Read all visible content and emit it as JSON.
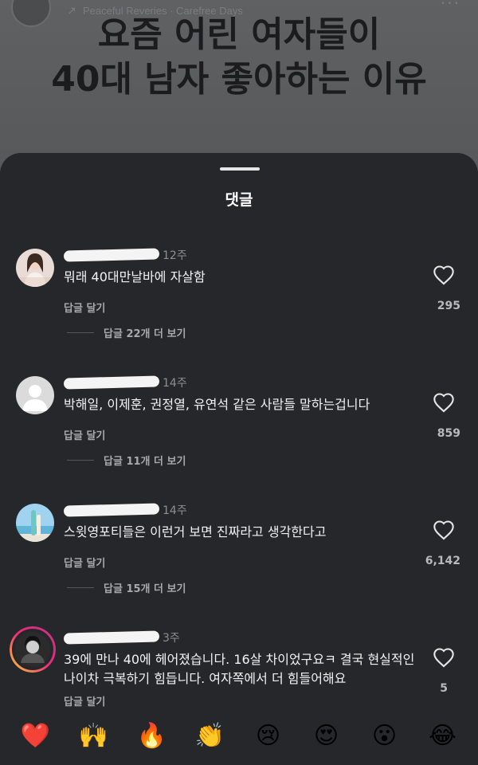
{
  "post": {
    "audio_label": "Peaceful Reveries · Carefree Days",
    "headline_line1": "요즘 어린 여자들이",
    "headline_line2": "40대 남자 좋아하는 이유",
    "more_label": "···"
  },
  "sheet": {
    "title": "댓글"
  },
  "comments": [
    {
      "time": "12주",
      "text": "뭐래 40대만날바에 자살함",
      "reply_label": "답글 달기",
      "likes": "295",
      "view_replies": "답글 22개 더 보기"
    },
    {
      "time": "14주",
      "text": "박해일, 이제훈, 권정열, 유연석 같은 사람들 말하는겁니다",
      "reply_label": "답글 달기",
      "likes": "859",
      "view_replies": "답글 11개 더 보기"
    },
    {
      "time": "14주",
      "text": "스윗영포티들은 이런거 보면 진짜라고 생각한다고",
      "reply_label": "답글 달기",
      "likes": "6,142",
      "view_replies": "답글 15개 더 보기"
    },
    {
      "time": "3주",
      "text": "39에 만나 40에 헤어졌습니다. 16살 차이었구요ㅋ 결국 현실적인 나이차 극복하기 힘듭니다. 여자쪽에서 더 힘들어해요",
      "reply_label": "답글 달기",
      "likes": "5"
    }
  ],
  "emoji_bar": [
    "❤️",
    "🙌",
    "🔥",
    "👏",
    "😢",
    "😍",
    "😮",
    "😂"
  ],
  "colors": {
    "sheet_bg": "#26272b",
    "text_primary": "#f2f2f2",
    "text_secondary": "#a8a8ad",
    "story_ring_start": "#f9ce34",
    "story_ring_end": "#c13584"
  }
}
